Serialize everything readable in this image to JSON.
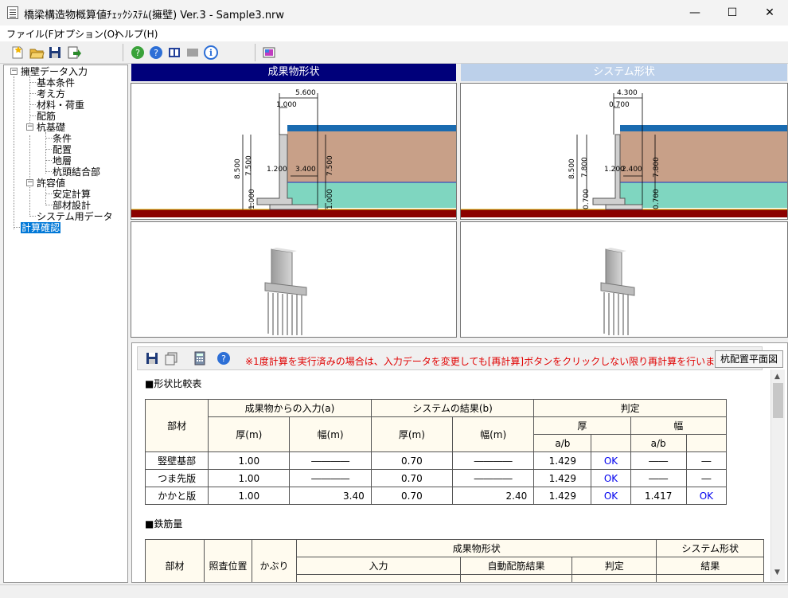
{
  "window": {
    "title": "橋梁構造物概算値ﾁｪｯｸｼｽﾃﾑ(擁壁) Ver.3 - Sample3.nrw",
    "minimize": "—",
    "maximize": "☐",
    "close": "✕"
  },
  "menu": [
    "ファイル(F)",
    "オプション(O)",
    "ヘルプ(H)"
  ],
  "tree": {
    "root": "擁壁データ入力",
    "items": [
      "基本条件",
      "考え方",
      "材料・荷重",
      "配筋",
      "杭基礎",
      "条件",
      "配置",
      "地層",
      "杭頭結合部",
      "許容値",
      "安定計算",
      "部材設計",
      "システム用データ",
      "計算確認"
    ],
    "box_minus": "−"
  },
  "panels": {
    "left_header": "成果物形状",
    "right_header": "システム形状"
  },
  "drawing_left": {
    "dim_top1": "5.600",
    "dim_top2": "1.000",
    "dim_h1": "8.500",
    "dim_h2": "7.500",
    "dim_h3": "7.500",
    "dim_mid1": "1.200",
    "dim_mid2": "3.400",
    "dim_b1": "1.000",
    "dim_b2": "1.000"
  },
  "drawing_right": {
    "dim_top1": "4.300",
    "dim_top2": "0.700",
    "dim_h1": "8.500",
    "dim_h2": "7.800",
    "dim_h3": "7.800",
    "dim_mid1": "1.200",
    "dim_mid2": "2.400",
    "dim_b1": "0.700",
    "dim_b2": "0.700"
  },
  "report": {
    "notice": "※1度計算を実行済みの場合は、入力データを変更しても[再計算]ボタンをクリックしない限り再計算を行いません。",
    "pile_plan_button": "杭配置平面図",
    "section1": "■形状比較表",
    "section2": "■鉄筋量",
    "table1": {
      "h_member": "部材",
      "h_input": "成果物からの入力(a)",
      "h_system": "システムの結果(b)",
      "h_judge": "判定",
      "h_thick": "厚(m)",
      "h_width": "幅(m)",
      "h_thick_j": "厚",
      "h_width_j": "幅",
      "h_ab": "a/b",
      "rows": [
        {
          "name": "竪壁基部",
          "ta": "1.00",
          "wa": "――――",
          "tb": "0.70",
          "wb": "――――",
          "r1": "1.429",
          "j1": "OK",
          "r2": "――",
          "j2": "―"
        },
        {
          "name": "つま先版",
          "ta": "1.00",
          "wa": "――――",
          "tb": "0.70",
          "wb": "――――",
          "r1": "1.429",
          "j1": "OK",
          "r2": "――",
          "j2": "―"
        },
        {
          "name": "かかと版",
          "ta": "1.00",
          "wa": "3.40",
          "tb": "0.70",
          "wb": "2.40",
          "r1": "1.429",
          "j1": "OK",
          "r2": "1.417",
          "j2": "OK"
        }
      ]
    },
    "table2": {
      "h_member": "部材",
      "h_pos": "照査位置",
      "h_cover": "かぶり",
      "h_product": "成果物形状",
      "h_system": "システム形状",
      "h_input": "入力",
      "h_auto": "自動配筋結果",
      "h_judge": "判定",
      "h_result": "結果"
    }
  },
  "colors": {
    "accent_header": "#00007a",
    "inactive_header": "#bcd0ea",
    "soil": "#c8a088",
    "groundwater": "#7fd6c0",
    "base_red": "#8b0000",
    "ok_text": "#0000ee",
    "notice_text": "#e00000",
    "table_bg": "#fffbef"
  }
}
